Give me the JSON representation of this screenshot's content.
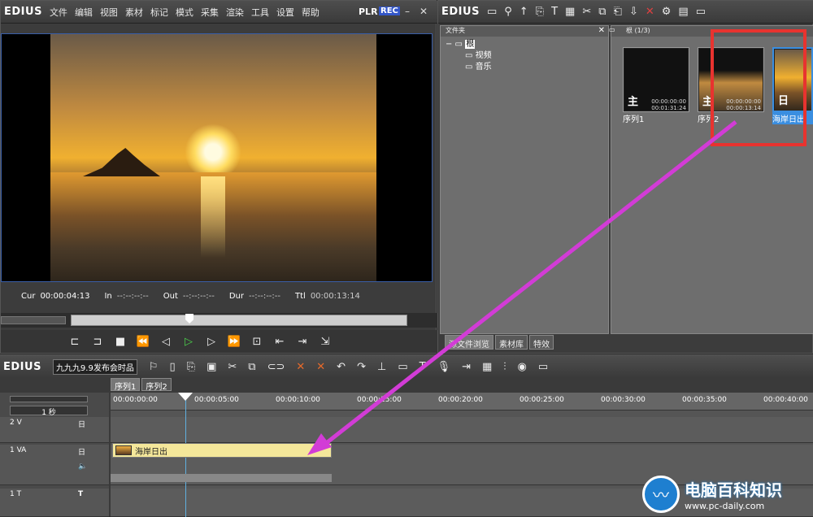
{
  "player": {
    "brand": "EDIUS",
    "menu": [
      "文件",
      "编辑",
      "视图",
      "素材",
      "标记",
      "模式",
      "采集",
      "渲染",
      "工具",
      "设置",
      "帮助"
    ],
    "plr": "PLR",
    "rec": "REC",
    "minimize": "–",
    "close": "✕",
    "timecodes": {
      "cur_label": "Cur",
      "cur": "00:00:04:13",
      "in_label": "In",
      "in": "--:--:--:--",
      "out_label": "Out",
      "out": "--:--:--:--",
      "dur_label": "Dur",
      "dur": "--:--:--:--",
      "ttl_label": "Ttl",
      "ttl": "00:00:13:14"
    },
    "scrub_progress": 0.34
  },
  "bin": {
    "brand": "EDIUS",
    "folder_header": "文件夹",
    "tree": {
      "root": "根",
      "children": [
        "视频",
        "音乐"
      ]
    },
    "clip_header": "根 (1/3)",
    "clips": [
      {
        "name": "序列1",
        "tc_top": "00:00:00:00",
        "tc_bottom": "00:01:31:24",
        "symbol": "主"
      },
      {
        "name": "序列2",
        "tc_top": "00:00:00:00",
        "tc_bottom": "00:00:13:14",
        "symbol": "主"
      },
      {
        "name": "海岸日出",
        "tc_top": "",
        "tc_bottom": "",
        "symbol": "日"
      }
    ],
    "tabs": [
      "源文件浏览",
      "素材库",
      "特效"
    ]
  },
  "timeline": {
    "brand": "EDIUS",
    "project": "九九九9.9发布会时品",
    "sequence_tabs": [
      "序列1",
      "序列2"
    ],
    "zoom": "1 秒",
    "ruler": [
      "00:00:00:00",
      "00:00:05:00",
      "00:00:10:00",
      "00:00:15:00",
      "00:00:20:00",
      "00:00:25:00",
      "00:00:30:00",
      "00:00:35:00",
      "00:00:40:00"
    ],
    "tracks": [
      {
        "name": "2 V",
        "type_icon": "日"
      },
      {
        "name": "1 VA",
        "type_icon": "日"
      },
      {
        "name": "1 T",
        "type_icon": "T"
      }
    ],
    "clip_name": "海岸日出"
  },
  "watermark": {
    "title": "电脑百科知识",
    "url": "www.pc-daily.com"
  },
  "colors": {
    "highlight": "#e8332f",
    "arrow": "#d23cd6",
    "clip_fill": "#f4e79a",
    "play": "#4cd34c",
    "rec": "#3356c8"
  }
}
